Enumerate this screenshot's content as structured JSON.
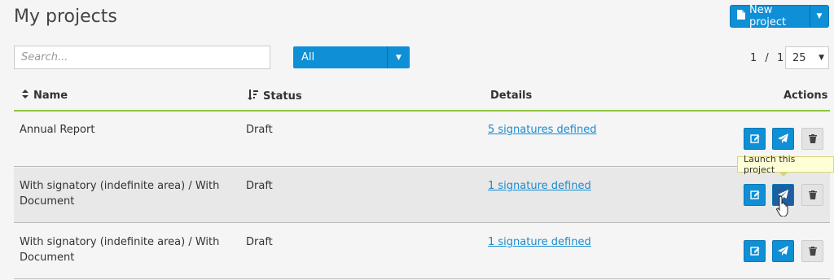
{
  "page": {
    "title": "My projects"
  },
  "toolbar": {
    "new_project_label": "New project"
  },
  "search": {
    "placeholder": "Search..."
  },
  "filter": {
    "selected": "All"
  },
  "pagination": {
    "current": "1",
    "separator": "/",
    "total": "1",
    "per_page": "25"
  },
  "table": {
    "headers": {
      "name": "Name",
      "status": "Status",
      "details": "Details",
      "actions": "Actions"
    },
    "rows": [
      {
        "name_line1": "Annual Report",
        "name_line2": "",
        "status": "Draft",
        "details": "5 signatures defined"
      },
      {
        "name_line1": "With signatory (indefinite area) / With",
        "name_line2": "Document",
        "status": "Draft",
        "details": "1 signature defined"
      },
      {
        "name_line1": "With signatory (indefinite area) / With",
        "name_line2": "Document",
        "status": "Draft",
        "details": "1 signature defined"
      }
    ]
  },
  "tooltip": {
    "text": "Launch this project"
  },
  "icons": {
    "new_project": "document-icon",
    "sort_name": "sort-icon",
    "sort_status": "sort-descending-icon",
    "edit": "edit-icon",
    "launch": "paper-plane-icon",
    "delete": "trash-icon"
  },
  "colors": {
    "accent": "#0e8fd6",
    "header_rule": "#8ec63f",
    "link": "#1a8ccf",
    "tooltip_bg": "#ffffd6"
  }
}
